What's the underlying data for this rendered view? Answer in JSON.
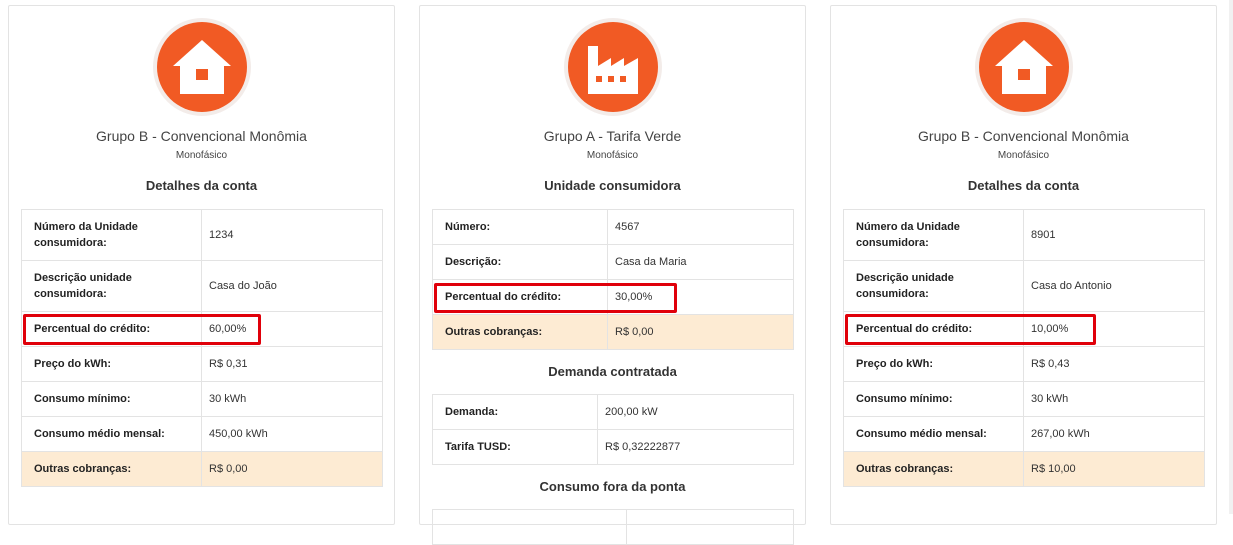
{
  "cards": [
    {
      "icon": "house-icon",
      "group": "Grupo B - Convencional Monômia",
      "phase": "Monofásico",
      "sections": [
        {
          "title": "Detalhes da conta",
          "rows": [
            {
              "label": "Número da Unidade consumidora:",
              "value": "1234"
            },
            {
              "label": "Descrição unidade consumidora:",
              "value": "Casa do João"
            },
            {
              "label": "Percentual do crédito:",
              "value": "60,00%"
            },
            {
              "label": "Preço do kWh:",
              "value": "R$ 0,31"
            },
            {
              "label": "Consumo mínimo:",
              "value": "30 kWh"
            },
            {
              "label": "Consumo médio mensal:",
              "value": "450,00 kWh"
            },
            {
              "label": "Outras cobranças:",
              "value": "R$ 0,00"
            }
          ]
        }
      ]
    },
    {
      "icon": "factory-icon",
      "group": "Grupo A - Tarifa Verde",
      "phase": "Monofásico",
      "sections": [
        {
          "title": "Unidade consumidora",
          "rows": [
            {
              "label": "Número:",
              "value": "4567"
            },
            {
              "label": "Descrição:",
              "value": "Casa da Maria"
            },
            {
              "label": "Percentual do crédito:",
              "value": "30,00%"
            },
            {
              "label": "Outras cobranças:",
              "value": "R$ 0,00"
            }
          ]
        },
        {
          "title": "Demanda contratada",
          "rows": [
            {
              "label": "Demanda:",
              "value": "200,00 kW"
            },
            {
              "label": "Tarifa TUSD:",
              "value": "R$ 0,32222877"
            }
          ]
        },
        {
          "title": "Consumo fora da ponta",
          "rows": []
        }
      ]
    },
    {
      "icon": "house-icon",
      "group": "Grupo B - Convencional Monômia",
      "phase": "Monofásico",
      "sections": [
        {
          "title": "Detalhes da conta",
          "rows": [
            {
              "label": "Número da Unidade consumidora:",
              "value": "8901"
            },
            {
              "label": "Descrição unidade consumidora:",
              "value": "Casa do Antonio"
            },
            {
              "label": "Percentual do crédito:",
              "value": "10,00%"
            },
            {
              "label": "Preço do kWh:",
              "value": "R$ 0,43"
            },
            {
              "label": "Consumo mínimo:",
              "value": "30 kWh"
            },
            {
              "label": "Consumo médio mensal:",
              "value": "267,00 kWh"
            },
            {
              "label": "Outras cobranças:",
              "value": "R$ 10,00"
            }
          ]
        }
      ]
    }
  ],
  "colors": {
    "accent": "#f15a24",
    "highlight_row": "#fdebd3",
    "annotation_box": "#e0000a"
  }
}
